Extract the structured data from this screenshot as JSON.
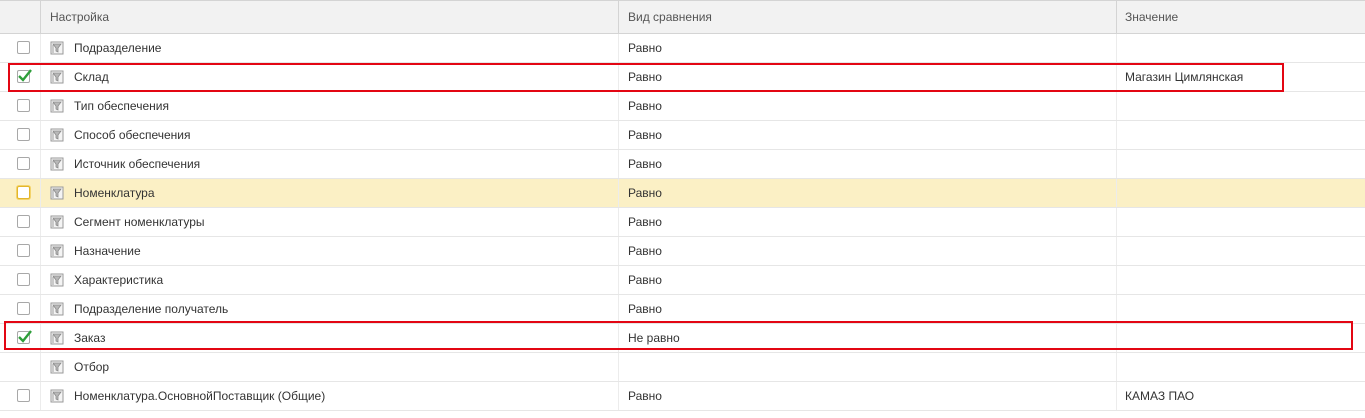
{
  "columns": {
    "setting": "Настройка",
    "comparison": "Вид сравнения",
    "value": "Значение"
  },
  "rows": [
    {
      "name": "Подразделение",
      "comparison": "Равно",
      "value": "",
      "checked": false
    },
    {
      "name": "Склад",
      "comparison": "Равно",
      "value": "Магазин Цимлянская",
      "checked": true
    },
    {
      "name": "Тип обеспечения",
      "comparison": "Равно",
      "value": "",
      "checked": false
    },
    {
      "name": "Способ обеспечения",
      "comparison": "Равно",
      "value": "",
      "checked": false
    },
    {
      "name": "Источник обеспечения",
      "comparison": "Равно",
      "value": "",
      "checked": false
    },
    {
      "name": "Номенклатура",
      "comparison": "Равно",
      "value": "",
      "checked": false,
      "current": true
    },
    {
      "name": "Сегмент номенклатуры",
      "comparison": "Равно",
      "value": "",
      "checked": false
    },
    {
      "name": "Назначение",
      "comparison": "Равно",
      "value": "",
      "checked": false
    },
    {
      "name": "Характеристика",
      "comparison": "Равно",
      "value": "",
      "checked": false
    },
    {
      "name": "Подразделение получатель",
      "comparison": "Равно",
      "value": "",
      "checked": false
    },
    {
      "name": "Заказ",
      "comparison": "Не равно",
      "value": "",
      "checked": true
    },
    {
      "name": "Отбор",
      "comparison": "",
      "value": "",
      "checked": false,
      "group": true
    },
    {
      "name": "Номенклатура.ОсновнойПоставщик (Общие)",
      "comparison": "Равно",
      "value": "КАМАЗ ПАО",
      "checked": false
    }
  ],
  "colors": {
    "header_bg": "#f2f2f2",
    "current_row_bg": "#fbf0c5",
    "check_green": "#2e9e3a",
    "highlight_red": "#e30613"
  },
  "icons": {
    "row_icon": "filter-field-icon",
    "check": "checkmark-icon"
  }
}
